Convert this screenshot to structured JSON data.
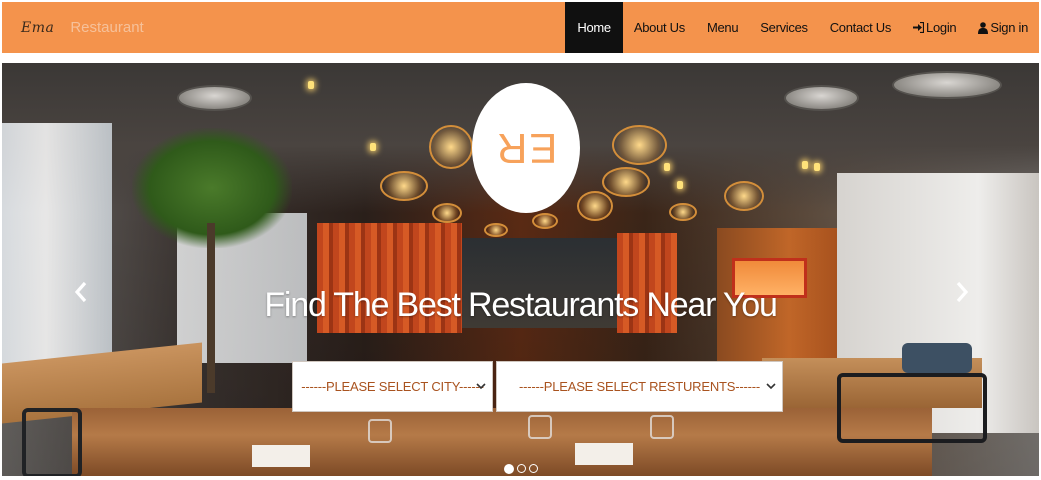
{
  "brand": {
    "script": "Ema",
    "word": "Restaurant"
  },
  "nav": {
    "home": "Home",
    "about": "About Us",
    "menu": "Menu",
    "services": "Services",
    "contact": "Contact Us",
    "login": "Login",
    "signin": "Sign in",
    "login_icon": "login-arrow-icon",
    "signin_icon": "user-icon"
  },
  "hero": {
    "logo_text": "ER",
    "title": "Find The Best Restaurants Near You",
    "prev_icon": "chevron-left-icon",
    "next_icon": "chevron-right-icon",
    "active_slide": 1,
    "slide_count": 3
  },
  "search": {
    "city_selected": "------PLEASE SELECT CITY------",
    "restaurant_selected": "------PLEASE SELECT RESTURENTS------"
  },
  "colors": {
    "navbar": "#f4934c",
    "active_nav": "#101010",
    "logo_text": "#f7a25b",
    "select_text": "#a9531f"
  }
}
